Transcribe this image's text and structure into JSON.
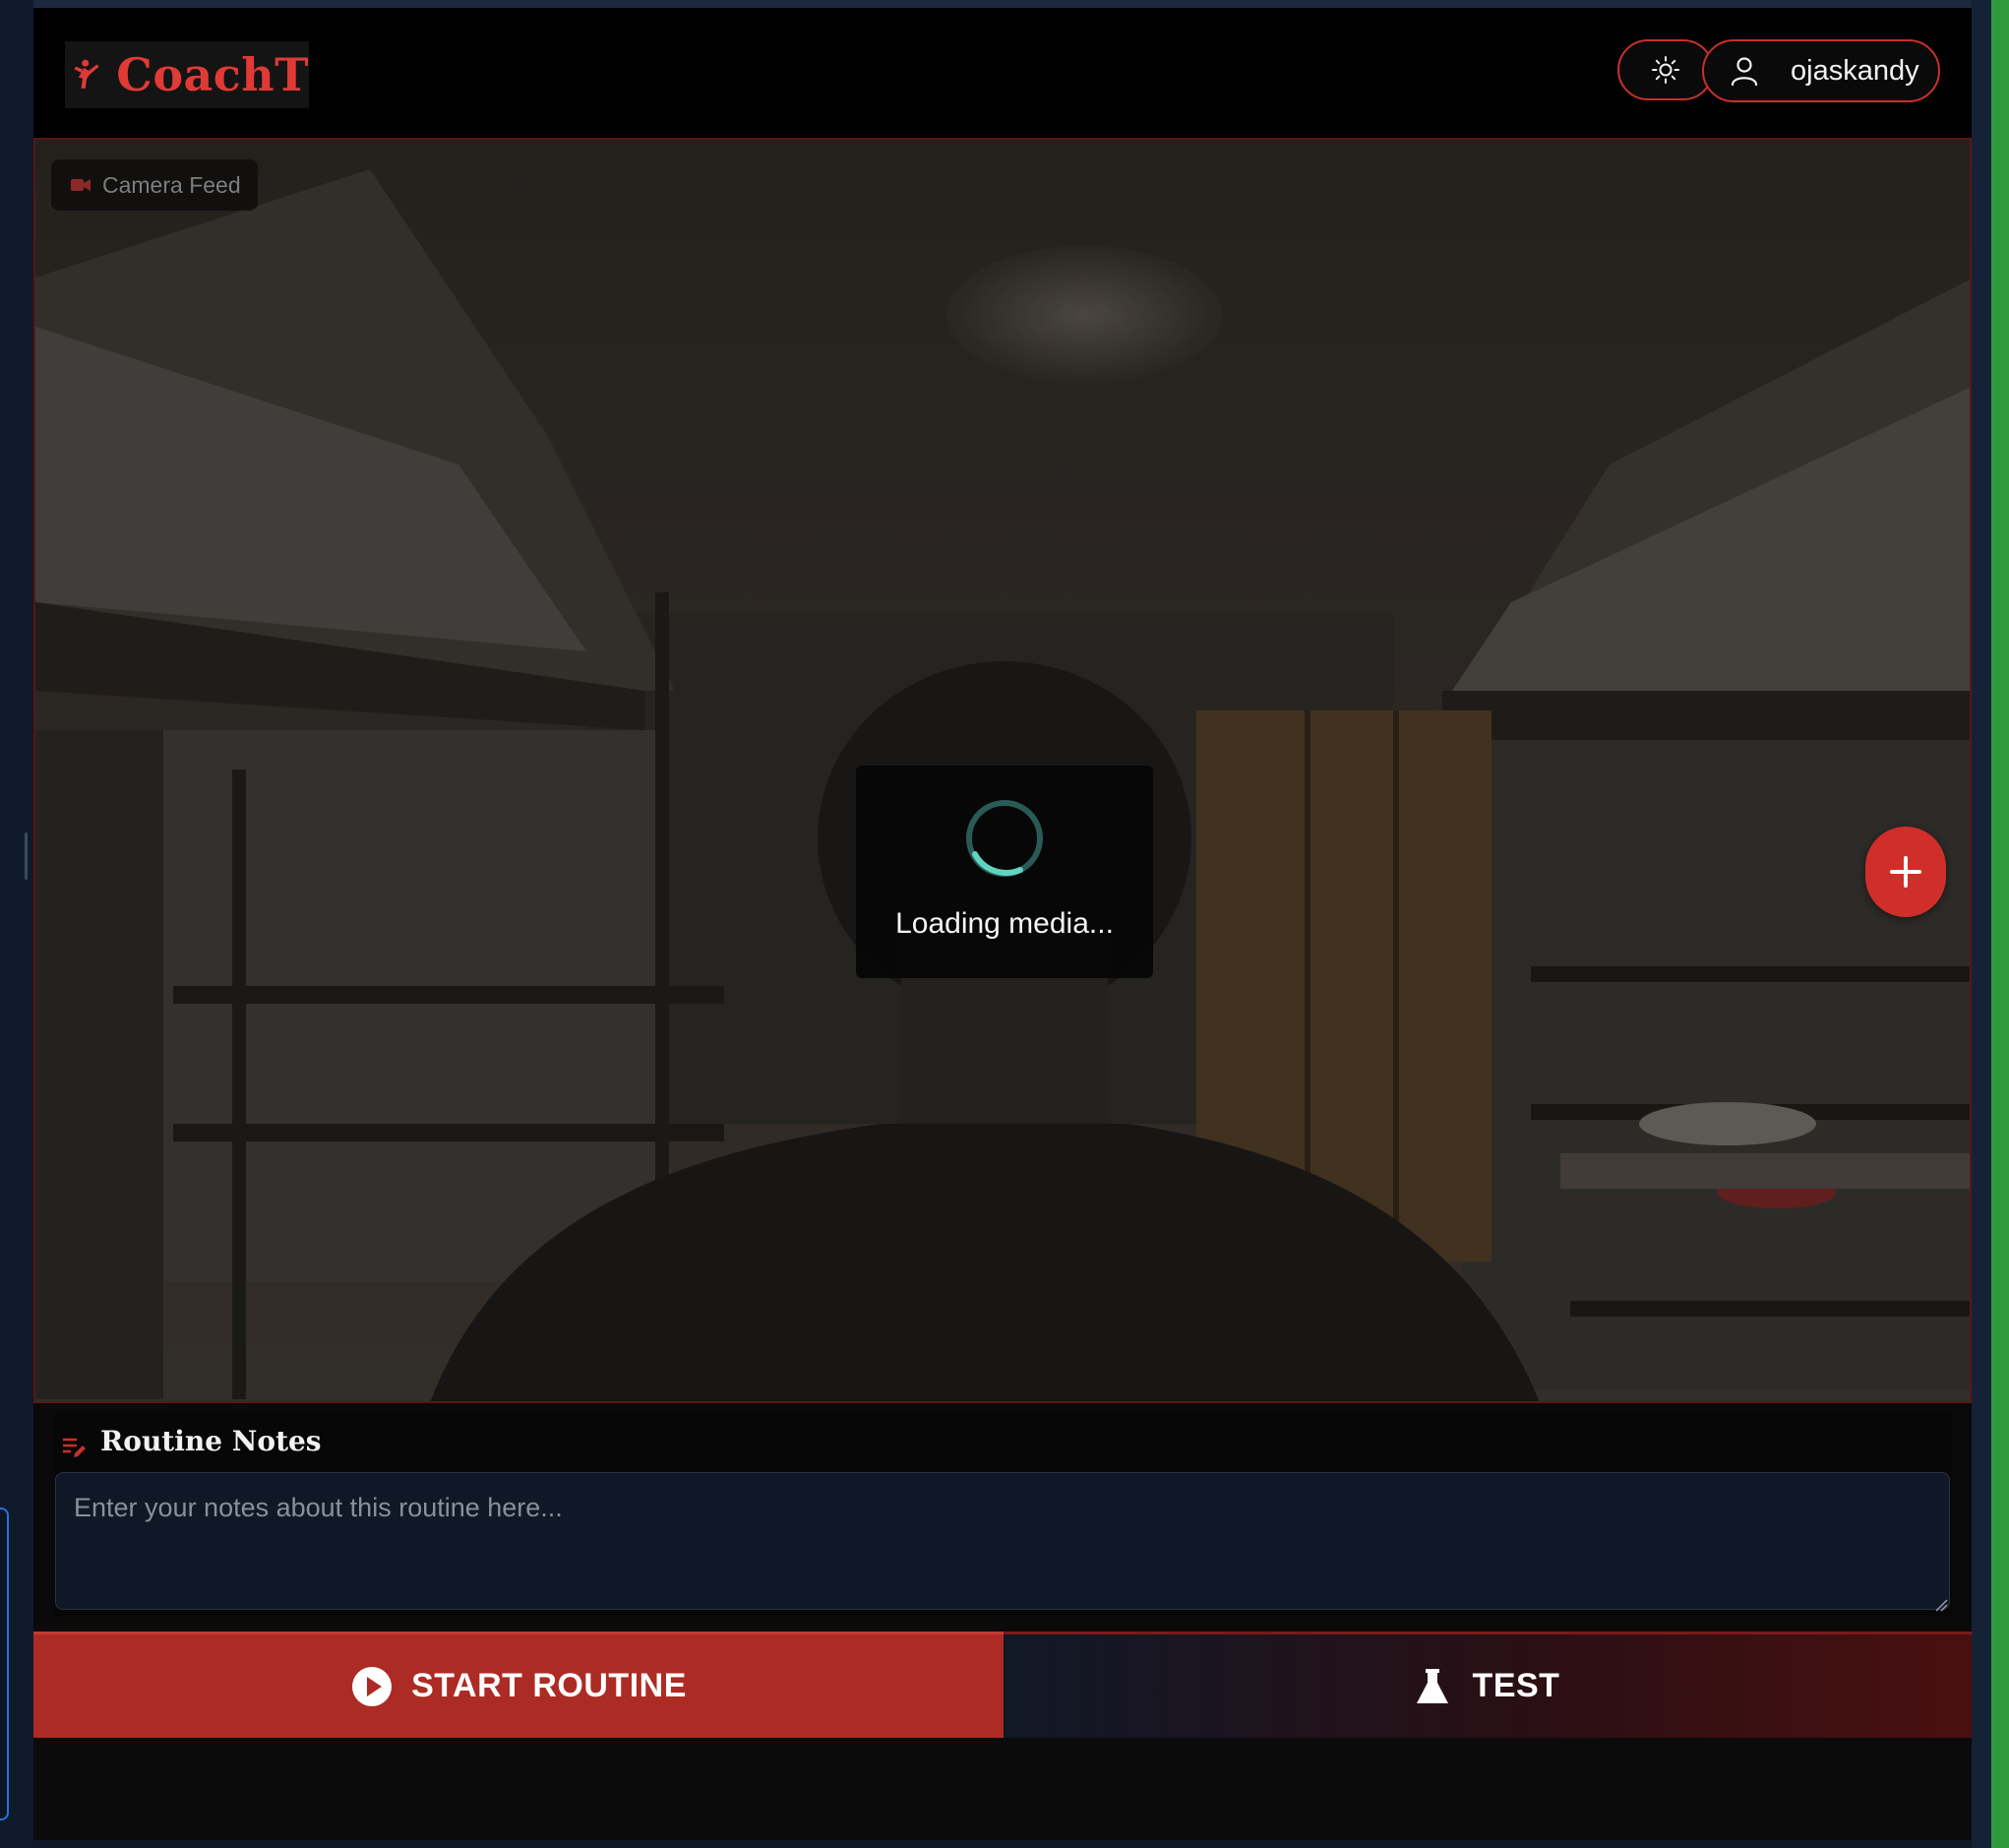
{
  "app": {
    "brand": "CoachT",
    "accent_color": "#e03a36",
    "button_red": "#ad2b25"
  },
  "header": {
    "theme_toggle_icon": "sun-icon",
    "user": {
      "icon": "user-icon",
      "name": "ojaskandy"
    }
  },
  "camera": {
    "label_icon": "video-camera-icon",
    "label": "Camera Feed",
    "loading_text": "Loading media...",
    "fab_icon": "plus-icon"
  },
  "notes": {
    "icon": "edit-list-icon",
    "title": "Routine Notes",
    "value": "",
    "placeholder": "Enter your notes about this routine here..."
  },
  "actions": {
    "start": {
      "icon": "play-circle-icon",
      "label": "START ROUTINE"
    },
    "test": {
      "icon": "flask-icon",
      "label": "TEST"
    }
  }
}
